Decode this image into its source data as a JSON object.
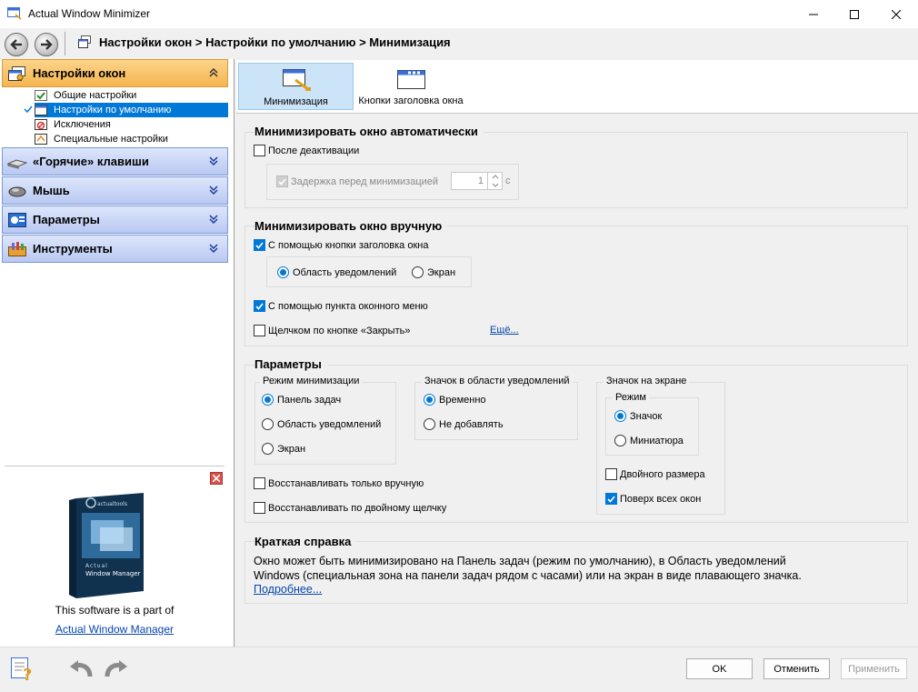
{
  "window": {
    "title": "Actual Window Minimizer",
    "icons": {
      "app": "app-icon",
      "minimize": "minimize-icon",
      "maximize": "maximize-icon",
      "close": "close-icon"
    }
  },
  "nav": {
    "back_icon": "back-arrow-icon",
    "forward_icon": "forward-arrow-icon",
    "breadcrumb": "Настройки окон > Настройки по умолчанию > Минимизация"
  },
  "sidebar": {
    "groups": [
      {
        "label": "Настройки окон",
        "icon": "window-settings-icon",
        "expanded": true
      },
      {
        "label": "«Горячие» клавиши",
        "icon": "keyboard-icon",
        "expanded": false
      },
      {
        "label": "Мышь",
        "icon": "mouse-icon",
        "expanded": false
      },
      {
        "label": "Параметры",
        "icon": "options-icon",
        "expanded": false
      },
      {
        "label": "Инструменты",
        "icon": "tools-icon",
        "expanded": false
      }
    ],
    "items": [
      {
        "label": "Общие настройки",
        "icon": "general-settings-icon"
      },
      {
        "label": "Настройки по умолчанию",
        "icon": "default-settings-icon",
        "selected": true
      },
      {
        "label": "Исключения",
        "icon": "exclusions-icon"
      },
      {
        "label": "Специальные настройки",
        "icon": "special-settings-icon"
      }
    ],
    "promo": {
      "text": "This software is a part of",
      "link": "Actual Window Manager",
      "box_brand": "actualtools",
      "box_title_1": "Actual",
      "box_title_2": "Window Manager"
    }
  },
  "tabs": [
    {
      "label": "Минимизация",
      "icon": "minimize-window-icon",
      "active": true
    },
    {
      "label": "Кнопки заголовка окна",
      "icon": "title-buttons-icon",
      "active": false
    }
  ],
  "auto": {
    "title": "Минимизировать окно автоматически",
    "after_deactivation": {
      "label": "После деактивации",
      "checked": false
    },
    "delay": {
      "label": "Задержка перед минимизацией",
      "checked": true,
      "disabled": true,
      "value": "1",
      "unit": "с"
    }
  },
  "manual": {
    "title": "Минимизировать окно вручную",
    "title_button": {
      "label": "С помощью кнопки заголовка окна",
      "checked": true
    },
    "target_options": [
      {
        "label": "Область уведомлений",
        "selected": true
      },
      {
        "label": "Экран",
        "selected": false
      }
    ],
    "window_menu": {
      "label": "С помощью пункта оконного меню",
      "checked": true
    },
    "close_button": {
      "label": "Щелчком по кнопке «Закрыть»",
      "checked": false
    },
    "more_link": "Ещё..."
  },
  "params": {
    "title": "Параметры",
    "mode": {
      "label": "Режим минимизации",
      "options": [
        {
          "label": "Панель задач",
          "selected": true
        },
        {
          "label": "Область уведомлений",
          "selected": false
        },
        {
          "label": "Экран",
          "selected": false
        }
      ]
    },
    "tray_icon": {
      "label": "Значок в области уведомлений",
      "options": [
        {
          "label": "Временно",
          "selected": true
        },
        {
          "label": "Не добавлять",
          "selected": false
        }
      ]
    },
    "screen_icon": {
      "label": "Значок на экране",
      "mode_label": "Режим",
      "mode_options": [
        {
          "label": "Значок",
          "selected": true
        },
        {
          "label": "Миниатюра",
          "selected": false
        }
      ],
      "double_size": {
        "label": "Двойного размера",
        "checked": false
      },
      "on_top": {
        "label": "Поверх всех окон",
        "checked": true
      }
    },
    "restore_manual": {
      "label": "Восстанавливать только вручную",
      "checked": false
    },
    "restore_dblclick": {
      "label": "Восстанавливать по двойному щелчку",
      "checked": false
    }
  },
  "help": {
    "title": "Краткая справка",
    "line1": "Окно может быть минимизировано на Панель задач (режим по умолчанию), в Область уведомлений",
    "line2": "Windows (специальная зона на панели задач рядом с часами) или на экран в виде плавающего значка.",
    "more_link": "Подробнее..."
  },
  "bottom": {
    "help_icon": "help-icon",
    "undo_icon": "undo-icon",
    "redo_icon": "redo-icon",
    "ok": "OK",
    "cancel": "Отменить",
    "apply": "Применить"
  },
  "colors": {
    "accent": "#0078d7",
    "active_group": "#f5b54f",
    "inactive_group": "#b9c9f2",
    "link": "#0645ad"
  }
}
